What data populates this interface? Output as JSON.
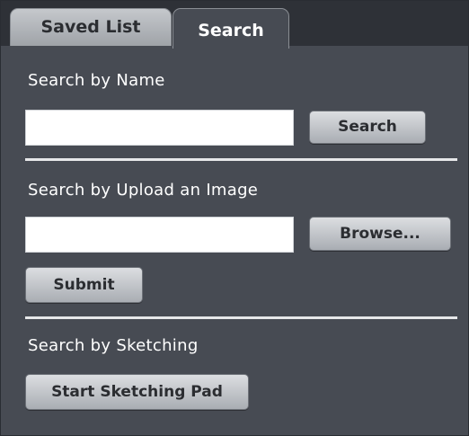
{
  "tabs": {
    "saved_list": "Saved List",
    "search": "Search"
  },
  "search_by_name": {
    "label": "Search by Name",
    "input_value": "",
    "button_label": "Search"
  },
  "search_by_upload": {
    "label": "Search by Upload an Image",
    "input_value": "",
    "browse_label": "Browse...",
    "submit_label": "Submit"
  },
  "search_by_sketching": {
    "label": "Search by Sketching",
    "button_label": "Start Sketching Pad"
  },
  "colors": {
    "panel_bg": "#474b53",
    "tabbar_bg": "#2e3137",
    "button_gradient_top": "#dcdee1",
    "button_gradient_bottom": "#a9adb3",
    "divider": "#e6e7e9"
  }
}
